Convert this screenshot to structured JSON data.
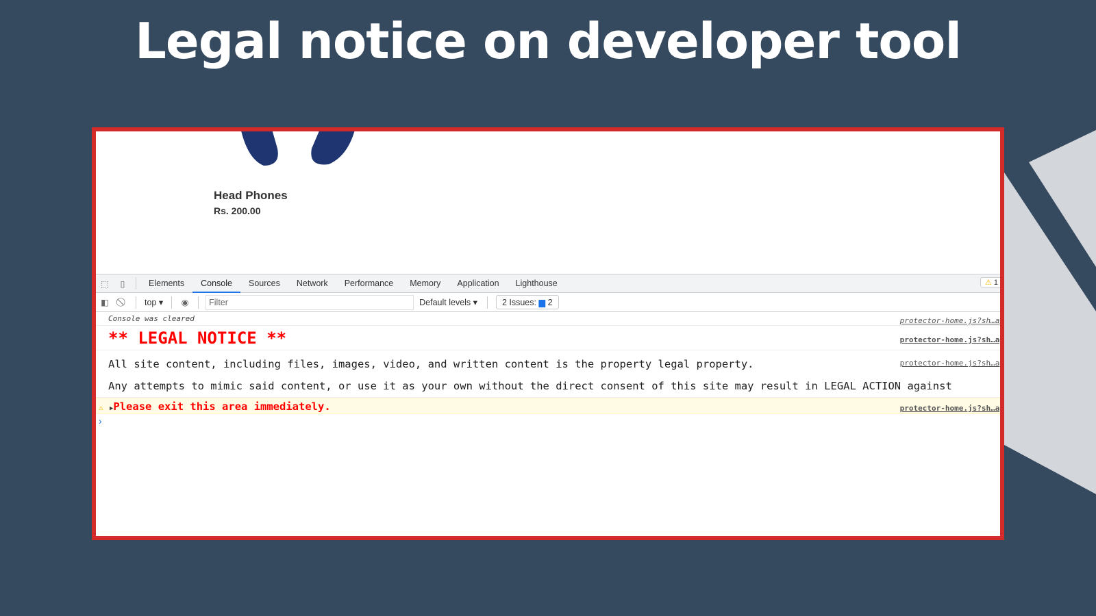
{
  "slide_title": "Legal notice on developer tool",
  "product": {
    "name": "Head Phones",
    "price": "Rs. 200.00"
  },
  "devtools": {
    "tabs": [
      "Elements",
      "Console",
      "Sources",
      "Network",
      "Performance",
      "Memory",
      "Application",
      "Lighthouse"
    ],
    "active_tab": "Console",
    "warning_count": "1",
    "context": "top",
    "filter_placeholder": "Filter",
    "levels": "Default levels",
    "issues_label": "2 Issues:",
    "issues_count": "2"
  },
  "console": {
    "cleared": "Console was cleared",
    "legal_heading": "** LEGAL NOTICE **",
    "line1": "All site content, including files, images, video, and written content is the property legal property.",
    "line2": "Any attempts to mimic said content, or use it as your own without the direct consent of this site may result in LEGAL ACTION against",
    "warning": "Please exit this area immediately.",
    "source": "protector-home.js?sh…ap",
    "prompt": "›"
  },
  "colors": {
    "background": "#35495f",
    "frame": "#d42a2a",
    "legal": "#ff0000",
    "accent": "#1a73e8"
  }
}
